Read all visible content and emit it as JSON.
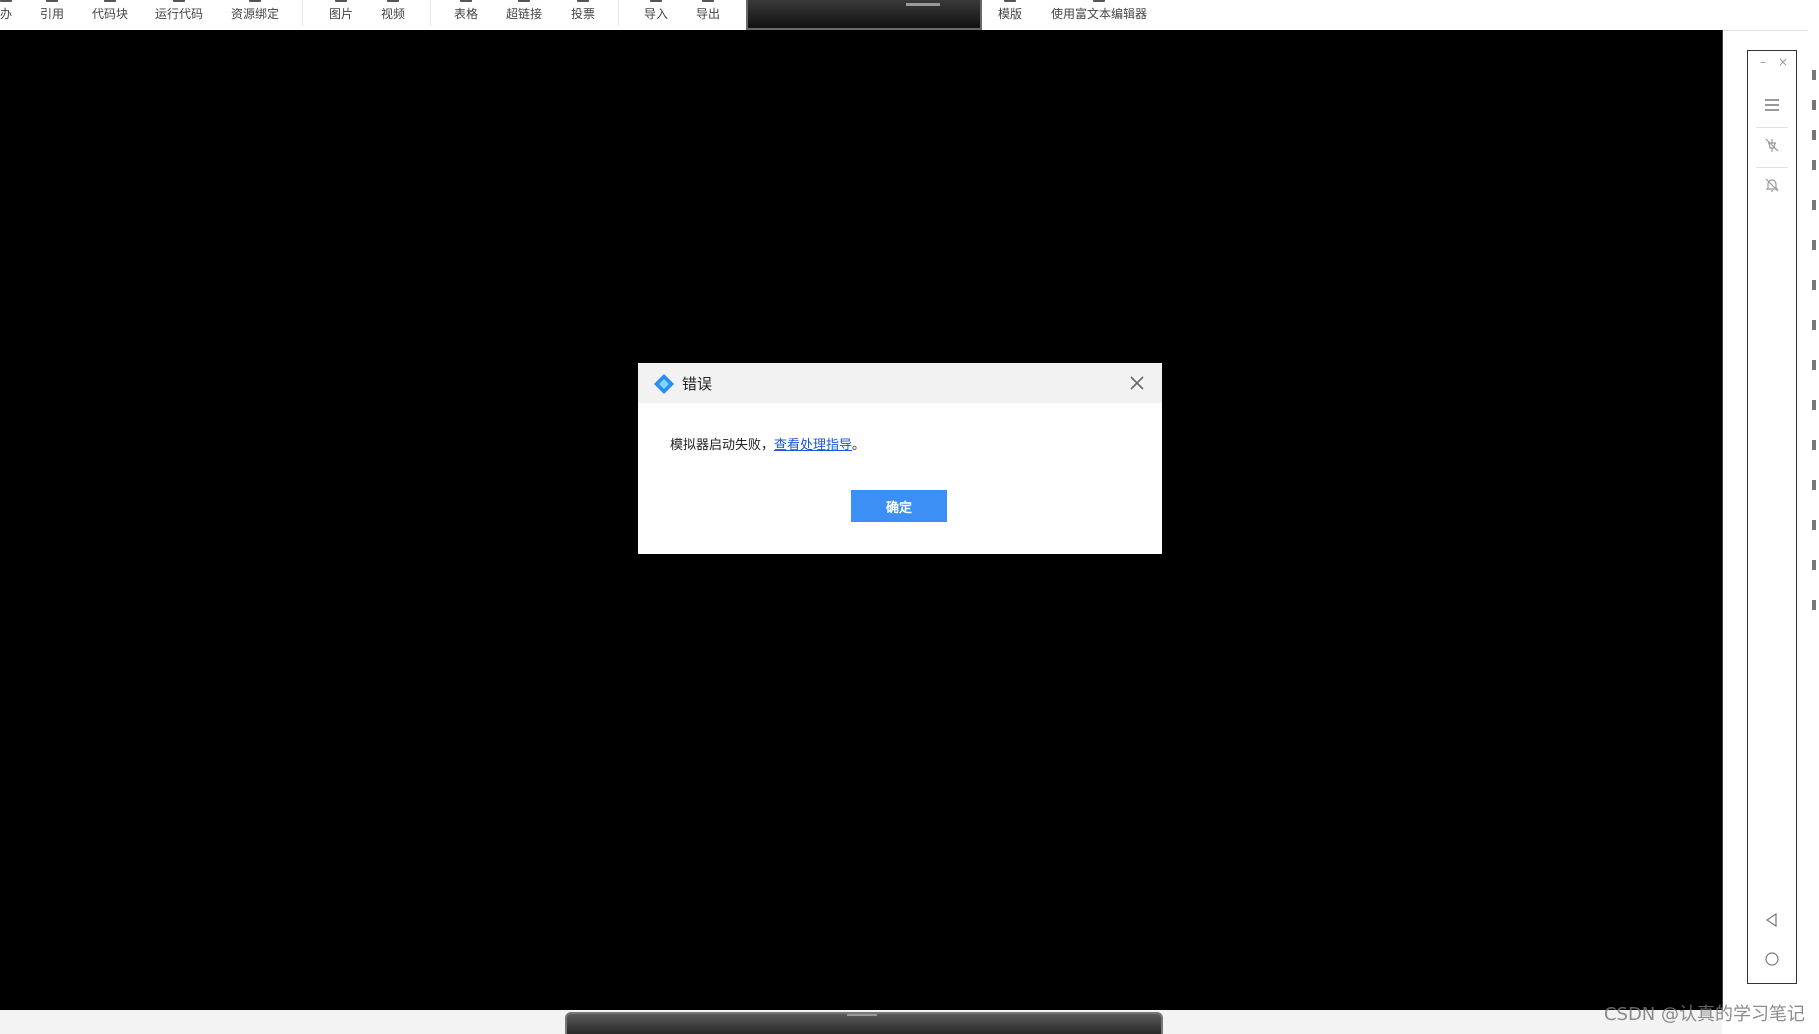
{
  "toolbar": {
    "items": [
      "办",
      "引用",
      "代码块",
      "运行代码",
      "资源绑定",
      "图片",
      "视频",
      "表格",
      "超链接",
      "投票",
      "导入",
      "导出",
      "模版",
      "使用富文本编辑器"
    ]
  },
  "dialog": {
    "title": "错误",
    "message": "模拟器启动失败，",
    "link": "查看处理指导",
    "message_end": "。",
    "ok_label": "确定"
  },
  "emulator_controls": {
    "minimize": "–",
    "close": "×",
    "icons": [
      "menu-icon",
      "pin-off-icon",
      "notification-off-icon",
      "back-triangle-icon",
      "home-circle-icon"
    ]
  },
  "watermark": "CSDN @认真的学习笔记",
  "colors": {
    "accent": "#3b8ff5",
    "link": "#1a56d6",
    "screen": "#000000"
  }
}
